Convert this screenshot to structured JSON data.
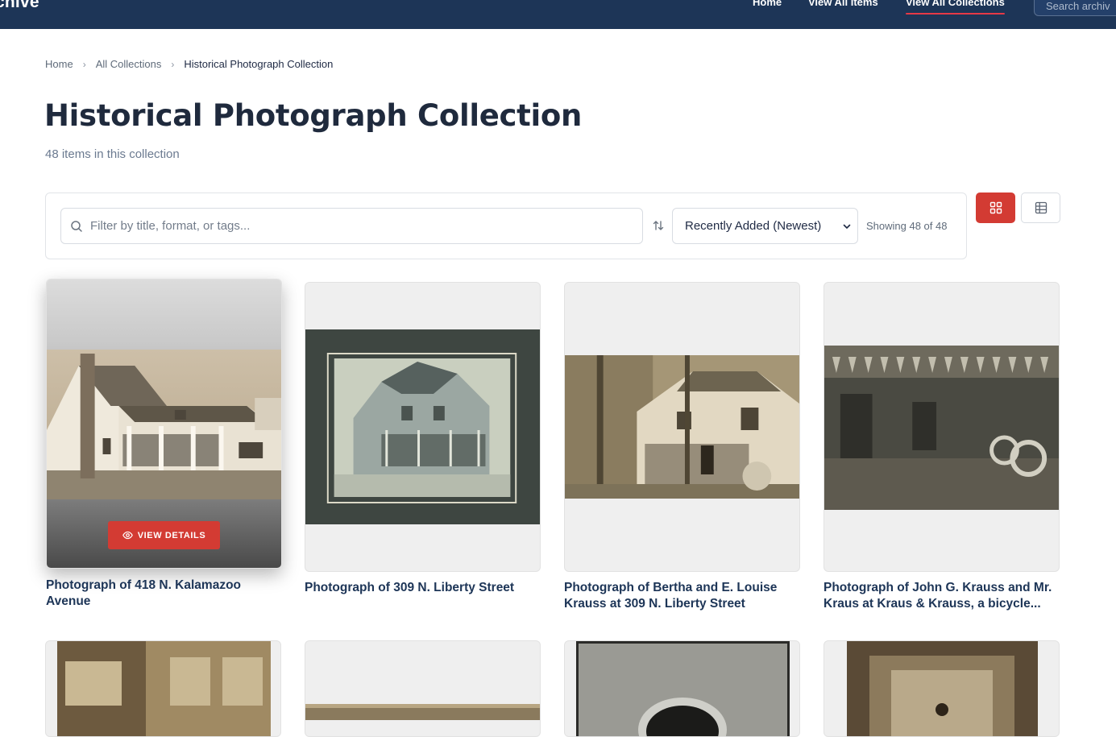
{
  "nav": {
    "brand": "chive",
    "links": [
      "Home",
      "View All Items",
      "View All Collections"
    ],
    "search_placeholder": "Search archiv"
  },
  "breadcrumb": {
    "items": [
      "Home",
      "All Collections",
      "Historical Photograph Collection"
    ]
  },
  "page": {
    "title": "Historical Photograph Collection",
    "count": "48 items in this collection"
  },
  "filter": {
    "placeholder": "Filter by title, format, or tags...",
    "sort_value": "Recently Added (Newest)",
    "showing": "Showing 48 of 48"
  },
  "colors": {
    "nav": "#1d3557",
    "accent": "#d33b33"
  },
  "cards": [
    {
      "title": "Photograph of 418 N. Kalamazoo Avenue",
      "action": "VIEW DETAILS"
    },
    {
      "title": "Photograph of 309 N. Liberty Street"
    },
    {
      "title": "Photograph of Bertha and E. Louise Krauss at 309 N. Liberty Street"
    },
    {
      "title": "Photograph of John G. Krauss and Mr. Kraus at Kraus & Krauss, a bicycle..."
    }
  ]
}
